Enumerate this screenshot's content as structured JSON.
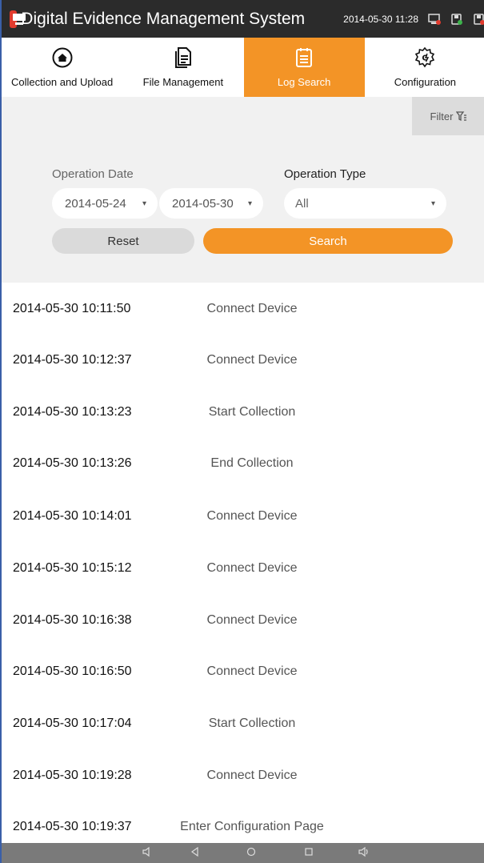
{
  "title_bar": {
    "app_title": "Digital Evidence Management System",
    "clock": "2014-05-30 11:28",
    "icons": [
      "device-disconnected-icon",
      "storage-ok-icon",
      "storage-alert-icon"
    ]
  },
  "tabs": [
    {
      "label": "Collection and Upload",
      "icon": "home-icon",
      "active": false
    },
    {
      "label": "File Management",
      "icon": "document-icon",
      "active": false
    },
    {
      "label": "Log Search",
      "icon": "log-icon",
      "active": true
    },
    {
      "label": "Configuration",
      "icon": "settings-gear-icon",
      "active": false
    }
  ],
  "filter": {
    "filter_label": "Filter",
    "operation_date_label": "Operation Date",
    "start_date": "2014-05-24",
    "end_date": "2014-05-30",
    "operation_type_label": "Operation Type",
    "operation_type_value": "All",
    "reset_label": "Reset",
    "search_label": "Search"
  },
  "logs": [
    {
      "time": "2014-05-30 10:11:50",
      "operation": "Connect Device"
    },
    {
      "time": "2014-05-30 10:12:37",
      "operation": "Connect Device"
    },
    {
      "time": "2014-05-30 10:13:23",
      "operation": "Start Collection"
    },
    {
      "time": "2014-05-30 10:13:26",
      "operation": "End Collection"
    },
    {
      "time": "2014-05-30 10:14:01",
      "operation": "Connect Device"
    },
    {
      "time": "2014-05-30 10:15:12",
      "operation": "Connect Device"
    },
    {
      "time": "2014-05-30 10:16:38",
      "operation": "Connect Device"
    },
    {
      "time": "2014-05-30 10:16:50",
      "operation": "Connect Device"
    },
    {
      "time": "2014-05-30 10:17:04",
      "operation": "Start Collection"
    },
    {
      "time": "2014-05-30 10:19:28",
      "operation": "Connect Device"
    },
    {
      "time": "2014-05-30 10:19:37",
      "operation": "Enter Configuration Page"
    }
  ],
  "colors": {
    "accent": "#f39426",
    "title_bar": "#2b2b2b",
    "panel": "#f1f1f1"
  }
}
